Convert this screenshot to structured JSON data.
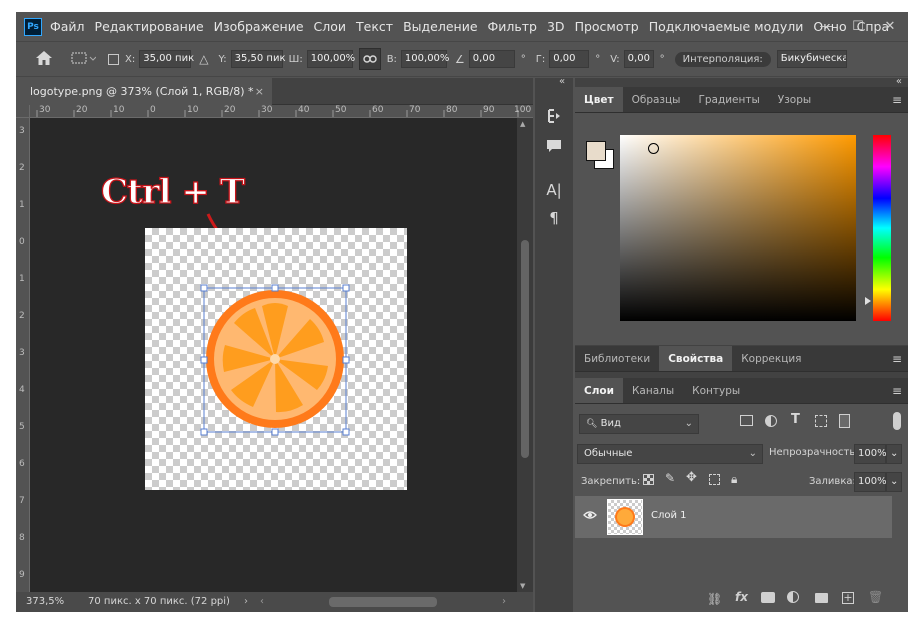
{
  "app": {
    "logo_text": "Ps",
    "menu": [
      "Файл",
      "Редактирование",
      "Изображение",
      "Слои",
      "Текст",
      "Выделение",
      "Фильтр",
      "3D",
      "Просмотр",
      "Подключаемые модули",
      "Окно",
      "Спра"
    ],
    "window_controls": {
      "minimize": "—",
      "maximize": "☐",
      "close": "✕"
    }
  },
  "options_bar": {
    "x_label": "X:",
    "x_value": "35,00 пик",
    "y_label": "Y:",
    "y_value": "35,50 пик",
    "w_label": "Ш:",
    "w_value": "100,00%",
    "h_label": "В:",
    "h_value": "100,00%",
    "angle_value": "0,00",
    "angle_unit": "°",
    "hskew_label": "Г:",
    "hskew_value": "0,00",
    "hskew_unit": "°",
    "vskew_label": "V:",
    "vskew_value": "0,00",
    "vskew_unit": "°",
    "interp_label": "Интерполяция:",
    "interp_value": "Бикубическая"
  },
  "document": {
    "tab_title": "logotype.png @ 373% (Слой 1, RGB/8) *",
    "close": "×",
    "ruler_top": [
      "30",
      "20",
      "10",
      "0",
      "10",
      "20",
      "30",
      "40",
      "50",
      "60",
      "70",
      "80",
      "90",
      "100"
    ],
    "ruler_left": [
      "3",
      "2",
      "1",
      "0",
      "1",
      "2",
      "3",
      "4",
      "5",
      "6",
      "7",
      "8",
      "9",
      "1"
    ],
    "annotation": "Ctrl + T",
    "zoom": "373,5%",
    "doc_size": "70 пикс. x 70 пикс. (72 ppi)"
  },
  "tools_dock": {
    "collapse": "«",
    "icons": [
      "history-icon",
      "comment-icon",
      "character-icon",
      "paragraph-icon"
    ],
    "character_glyph": "A|",
    "paragraph_glyph": "¶"
  },
  "color_panel": {
    "tabs": [
      "Цвет",
      "Образцы",
      "Градиенты",
      "Узоры"
    ],
    "active_tab": "Цвет",
    "menu_glyph": "≡",
    "fg_color": "#e8dccb",
    "bg_color": "#ffffff",
    "hue_color": "#ff9a00"
  },
  "props_panel": {
    "tabs": [
      "Библиотеки",
      "Свойства",
      "Коррекция"
    ],
    "active_tab": "Свойства"
  },
  "layers_panel": {
    "tabs": [
      "Слои",
      "Каналы",
      "Контуры"
    ],
    "active_tab": "Слои",
    "filter_label": "Вид",
    "blend_mode": "Обычные",
    "opacity_label": "Непрозрачность:",
    "opacity_value": "100%",
    "lock_label": "Закрепить:",
    "fill_label": "Заливка:",
    "fill_value": "100%",
    "layers": [
      {
        "name": "Слой 1",
        "visible": true
      }
    ]
  }
}
